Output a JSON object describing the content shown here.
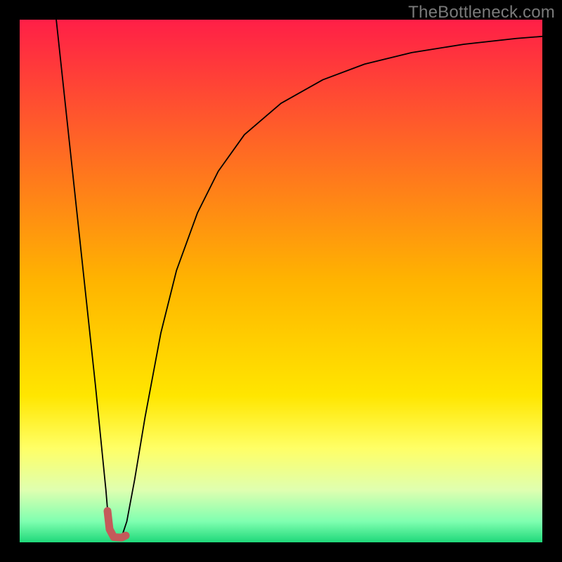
{
  "watermark": {
    "text": "TheBottleneck.com"
  },
  "chart_data": {
    "type": "line",
    "title": "",
    "xlabel": "",
    "ylabel": "",
    "xlim": [
      0,
      100
    ],
    "ylim": [
      0,
      100
    ],
    "background_gradient": {
      "stops": [
        {
          "offset": 0,
          "color": "#ff1f47"
        },
        {
          "offset": 50,
          "color": "#ffb400"
        },
        {
          "offset": 72,
          "color": "#ffe600"
        },
        {
          "offset": 82,
          "color": "#ffff66"
        },
        {
          "offset": 90,
          "color": "#dfffb0"
        },
        {
          "offset": 96,
          "color": "#7fffb0"
        },
        {
          "offset": 100,
          "color": "#1fd87a"
        }
      ]
    },
    "series": [
      {
        "name": "curve",
        "stroke": "#000000",
        "stroke_width": 1.8,
        "points": [
          {
            "x": 7.0,
            "y": 100.0
          },
          {
            "x": 8.5,
            "y": 86.0
          },
          {
            "x": 10.0,
            "y": 72.0
          },
          {
            "x": 11.5,
            "y": 58.0
          },
          {
            "x": 13.0,
            "y": 44.0
          },
          {
            "x": 14.5,
            "y": 30.0
          },
          {
            "x": 15.5,
            "y": 20.0
          },
          {
            "x": 16.5,
            "y": 10.0
          },
          {
            "x": 17.0,
            "y": 4.0
          },
          {
            "x": 17.5,
            "y": 1.2
          },
          {
            "x": 18.5,
            "y": 0.4
          },
          {
            "x": 19.5,
            "y": 1.0
          },
          {
            "x": 20.5,
            "y": 4.0
          },
          {
            "x": 22.0,
            "y": 12.0
          },
          {
            "x": 24.0,
            "y": 24.0
          },
          {
            "x": 27.0,
            "y": 40.0
          },
          {
            "x": 30.0,
            "y": 52.0
          },
          {
            "x": 34.0,
            "y": 63.0
          },
          {
            "x": 38.0,
            "y": 71.0
          },
          {
            "x": 43.0,
            "y": 78.0
          },
          {
            "x": 50.0,
            "y": 84.0
          },
          {
            "x": 58.0,
            "y": 88.5
          },
          {
            "x": 66.0,
            "y": 91.5
          },
          {
            "x": 75.0,
            "y": 93.7
          },
          {
            "x": 85.0,
            "y": 95.3
          },
          {
            "x": 95.0,
            "y": 96.4
          },
          {
            "x": 100.0,
            "y": 96.8
          }
        ]
      },
      {
        "name": "marker-hook",
        "stroke": "#c45a5a",
        "stroke_width": 11,
        "points": [
          {
            "x": 16.8,
            "y": 6.0
          },
          {
            "x": 17.2,
            "y": 2.5
          },
          {
            "x": 18.0,
            "y": 1.0
          },
          {
            "x": 19.5,
            "y": 0.9
          },
          {
            "x": 20.3,
            "y": 1.3
          }
        ]
      }
    ]
  }
}
